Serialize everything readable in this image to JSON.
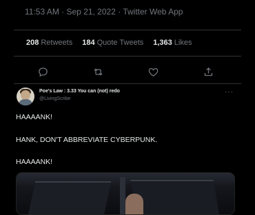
{
  "tweet": {
    "timestamp": "11:53 AM · Sep 21, 2022 · Twitter Web App",
    "stats": [
      {
        "count": "208",
        "label": "Retweets"
      },
      {
        "count": "184",
        "label": "Quote Tweets"
      },
      {
        "count": "1,363",
        "label": "Likes"
      }
    ],
    "actions": [
      "reply-icon",
      "retweet-icon",
      "like-icon",
      "share-icon"
    ]
  },
  "quote": {
    "name": "Poe's Law : 3.33 You can (not) redo",
    "handle": "@LivingScribe",
    "more": "···",
    "lines": [
      "HAAAANK!",
      "HANK, DON'T ABBREVIATE CYBERPUNK.",
      "HAAAANK!"
    ]
  },
  "colors": {
    "background": "#000000",
    "text": "#e7e9ea",
    "muted": "#71767b",
    "divider": "#2f3336"
  }
}
